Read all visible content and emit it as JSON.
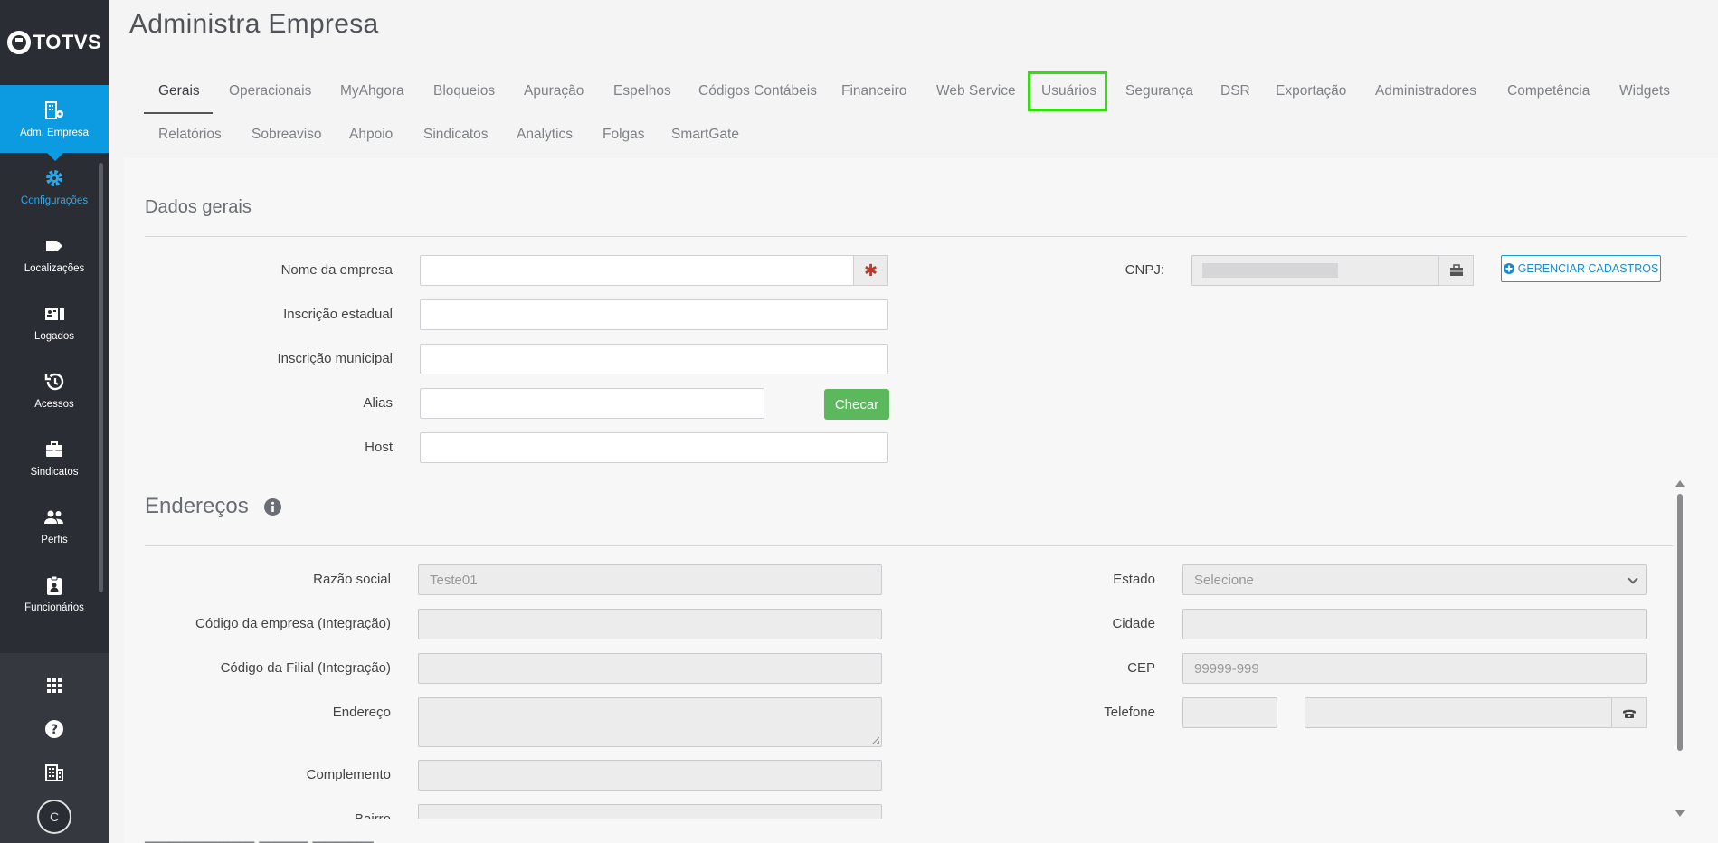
{
  "brand": {
    "name": "TOTVS"
  },
  "sidebar": {
    "items": [
      {
        "label": "Adm. Empresa",
        "icon": "building-gear-icon"
      },
      {
        "label": "Configurações",
        "icon": "gear-icon"
      },
      {
        "label": "Localizações",
        "icon": "tag-icon"
      },
      {
        "label": "Logados",
        "icon": "id-card-icon"
      },
      {
        "label": "Acessos",
        "icon": "history-icon"
      },
      {
        "label": "Sindicatos",
        "icon": "briefcase-icon"
      },
      {
        "label": "Perfis",
        "icon": "users-icon"
      },
      {
        "label": "Funcionários",
        "icon": "clipboard-user-icon"
      }
    ],
    "bottom_icons": [
      "apps-grid-icon",
      "help-icon",
      "company-icon"
    ],
    "avatar_initial": "C"
  },
  "header": {
    "title": "Administra Empresa"
  },
  "tabs": {
    "row1": [
      "Gerais",
      "Operacionais",
      "MyAhgora",
      "Bloqueios",
      "Apuração",
      "Espelhos",
      "Códigos Contábeis",
      "Financeiro",
      "Web Service",
      "Usuários",
      "Segurança",
      "DSR",
      "Exportação",
      "Administradores",
      "Competência",
      "Widgets"
    ],
    "row2": [
      "Relatórios",
      "Sobreaviso",
      "Ahpoio",
      "Sindicatos",
      "Analytics",
      "Folgas",
      "SmartGate"
    ],
    "active": "Gerais",
    "highlighted": "Usuários"
  },
  "dados_gerais": {
    "title": "Dados gerais",
    "nome_empresa_label": "Nome da empresa",
    "inscricao_estadual_label": "Inscrição estadual",
    "inscricao_municipal_label": "Inscrição municipal",
    "alias_label": "Alias",
    "checar_button": "Checar",
    "host_label": "Host",
    "cnpj_label": "CNPJ:",
    "gerenciar_button": "GERENCIAR CADASTROS"
  },
  "enderecos": {
    "title": "Endereços",
    "razao_social_label": "Razão social",
    "razao_social_value": "Teste01",
    "codigo_empresa_label": "Código da empresa (Integração)",
    "codigo_filial_label": "Código da Filial (Integração)",
    "endereco_label": "Endereço",
    "complemento_label": "Complemento",
    "bairro_label": "Bairro",
    "estado_label": "Estado",
    "estado_value": "Selecione",
    "cidade_label": "Cidade",
    "cep_label": "CEP",
    "cep_placeholder": "99999-999",
    "telefone_label": "Telefone"
  },
  "colors": {
    "accent": "#0c9be0",
    "success": "#5cb85c",
    "highlight": "#33dd11",
    "sidebar": "#2b2d34"
  }
}
